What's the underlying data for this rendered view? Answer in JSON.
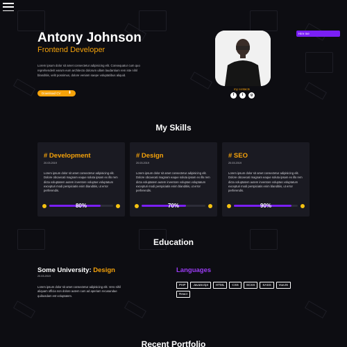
{
  "header": {
    "hire_label": "Hire me",
    "name": "Antony Johnson",
    "role": "Frontend Developer",
    "bio": "Lorem ipsum dolor sit amet consectetur adipisicing elit. Consequatur cum quo reprehenderit earum eum architecto dolorum ullam laudantium rem iste nihil blanditiis, velit possimus, dolore veniam saepe voluptatibus aliquid.",
    "download_label": "Download CV",
    "download_icon": "download-icon",
    "contacts_label": "my contacts",
    "socials": [
      {
        "icon": "facebook-icon",
        "glyph": "f"
      },
      {
        "icon": "twitter-icon",
        "glyph": "t"
      },
      {
        "icon": "github-icon",
        "glyph": "g"
      }
    ]
  },
  "skills": {
    "title": "My Skills",
    "cards": [
      {
        "title": "# Development",
        "date": "20.03.2019",
        "desc": "Lorem ipsum dolor sit amet consectetur adipisicing elit. Dolore obcaecati magnam eaque soluta ipsam ex illo rem dicta voluptatem autem inventore voluptas voluptatum excepturi modi perspiciatis enim blanditiis, ut error perferendis.",
        "percent": 80,
        "percent_label": "80%"
      },
      {
        "title": "# Design",
        "date": "20.03.2019",
        "desc": "Lorem ipsum dolor sit amet consectetur adipisicing elit. Dolore obcaecati magnam eaque soluta ipsam ex illo rem dicta voluptatem autem inventore voluptas voluptatum excepturi modi perspiciatis enim blanditiis, ut error perferendis.",
        "percent": 70,
        "percent_label": "70%"
      },
      {
        "title": "# SEO",
        "date": "20.03.2019",
        "desc": "Lorem ipsum dolor sit amet consectetur adipisicing elit. Dolore obcaecati magnam eaque soluta ipsam ex illo rem dicta voluptatem autem inventore voluptas voluptatum excepturi modi perspiciatis enim blanditiis, ut error perferendis.",
        "percent": 90,
        "percent_label": "90%"
      }
    ]
  },
  "education": {
    "title": "Education",
    "school_prefix": "Some University:",
    "school_accent": "Design",
    "date": "20.03.2019",
    "desc": "Lorem ipsum dolor sit amet consectetur adipisicing elit. Vero nihil aliquam officia non dolore autem cum ad aperiam recusandae quibusdam est voluptatem."
  },
  "languages": {
    "title": "Languages",
    "tags": [
      "PHP",
      "JavaScript",
      "HTML",
      "CSS",
      "SCSS",
      "SASS",
      "VueJS",
      "React"
    ]
  },
  "portfolio": {
    "title": "Recent Portfolio"
  },
  "colors": {
    "background": "#0d0d12",
    "accent_orange": "#f5a20a",
    "accent_purple": "#7a1ff5",
    "card_bg": "#1a1a22"
  }
}
